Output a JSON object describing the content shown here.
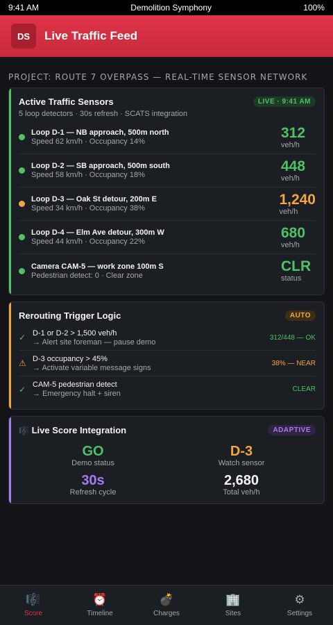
{
  "status_bar": {
    "time": "9:41 AM",
    "title": "Demolition Symphony",
    "battery": "100%"
  },
  "app": {
    "logo": "DS",
    "title": "Live Traffic Feed"
  },
  "project_label": "PROJECT: ROUTE 7 OVERPASS — REAL-TIME SENSOR NETWORK",
  "sensors_card": {
    "title": "Active Traffic Sensors",
    "badge": "LIVE · 9:41 AM",
    "subtitle": "5 loop detectors · 30s refresh · SCATS integration",
    "items": [
      {
        "name": "Loop D-1 — NB approach, 500m north",
        "detail": "Speed 62 km/h · Occupancy 14%",
        "value": "312",
        "unit": "veh/h",
        "color": "#4ec265"
      },
      {
        "name": "Loop D-2 — SB approach, 500m south",
        "detail": "Speed 58 km/h · Occupancy 18%",
        "value": "448",
        "unit": "veh/h",
        "color": "#4ec265"
      },
      {
        "name": "Loop D-3 — Oak St detour, 200m E",
        "detail": "Speed 34 km/h · Occupancy 38%",
        "value": "1,240",
        "unit": "veh/h",
        "color": "#f2a541"
      },
      {
        "name": "Loop D-4 — Elm Ave detour, 300m W",
        "detail": "Speed 44 km/h · Occupancy 22%",
        "value": "680",
        "unit": "veh/h",
        "color": "#4ec265"
      },
      {
        "name": "Camera CAM-5 — work zone 100m S",
        "detail": "Pedestrian detect: 0 · Clear zone",
        "value": "CLR",
        "unit": "status",
        "color": "#4ec265"
      }
    ]
  },
  "rerouting_card": {
    "title": "Rerouting Trigger Logic",
    "badge": "AUTO",
    "rules": [
      {
        "icon": "✓",
        "icon_name": "check-icon",
        "icon_color": "#4ec265",
        "condition": "D-1 or D-2 > 1,500 veh/h",
        "action": "→ Alert site foreman — pause demo",
        "status": "312/448 — OK",
        "status_color": "#4ec265"
      },
      {
        "icon": "⚠",
        "icon_name": "warning-icon",
        "icon_color": "#f2a541",
        "condition": "D-3 occupancy > 45%",
        "action": "→ Activate variable message signs",
        "status": "38% — NEAR",
        "status_color": "#f2a541"
      },
      {
        "icon": "✓",
        "icon_name": "check-icon",
        "icon_color": "#4ec265",
        "condition": "CAM-5 pedestrian detect",
        "action": "→ Emergency halt + siren",
        "status": "CLEAR",
        "status_color": "#4ec265"
      }
    ]
  },
  "score_card": {
    "icon": "🎼",
    "title": "Live Score Integration",
    "badge": "ADAPTIVE",
    "stats": [
      {
        "value": "GO",
        "label": "Demo status",
        "color": "#4ec265"
      },
      {
        "value": "D-3",
        "label": "Watch sensor",
        "color": "#f2a541"
      },
      {
        "value": "30s",
        "label": "Refresh cycle",
        "color": "#a77bf0"
      },
      {
        "value": "2,680",
        "label": "Total veh/h",
        "color": "#f2f3f5"
      }
    ]
  },
  "tabs": [
    {
      "icon": "🎼",
      "label": "Score",
      "active": true
    },
    {
      "icon": "⏰",
      "label": "Timeline",
      "active": false
    },
    {
      "icon": "💣",
      "label": "Charges",
      "active": false
    },
    {
      "icon": "🏢",
      "label": "Sites",
      "active": false
    },
    {
      "icon": "⚙",
      "label": "Settings",
      "active": false
    }
  ],
  "colors": {
    "accent_red": "#e0344a",
    "sensors_accent": "#4ec265",
    "rerouting_accent": "#f2a541",
    "score_accent": "#a77bf0"
  }
}
